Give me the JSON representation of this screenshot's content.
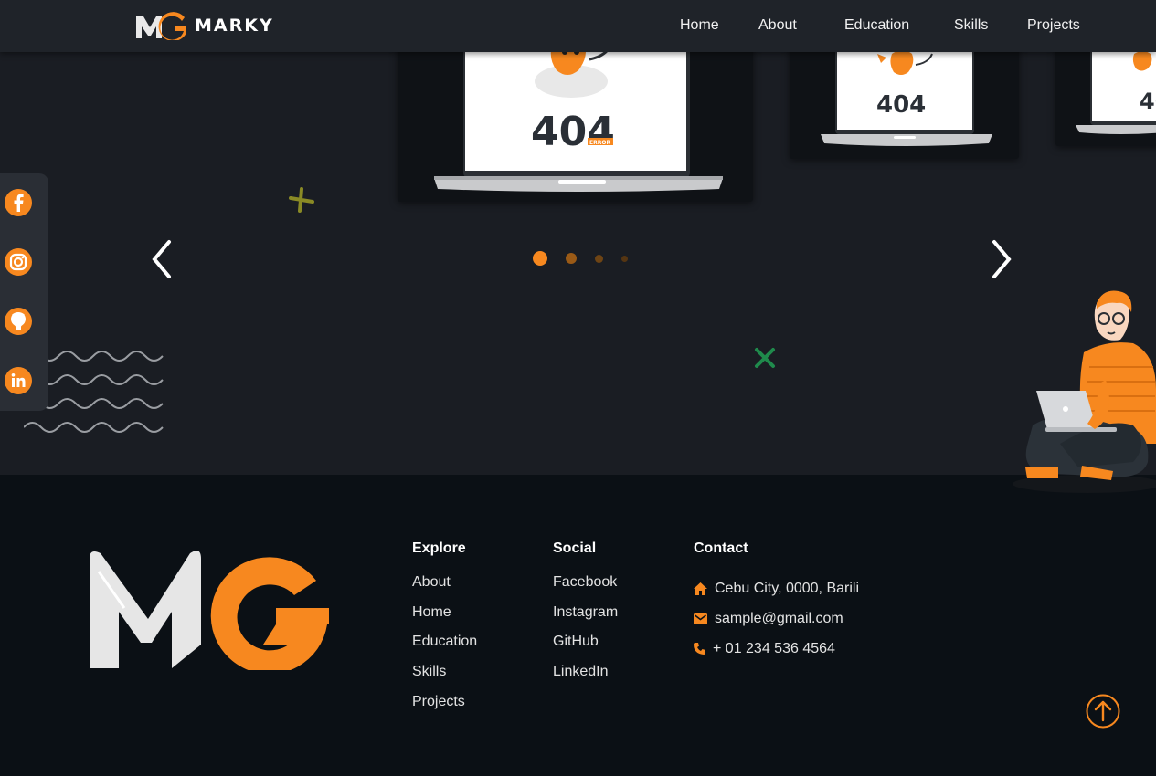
{
  "brand": {
    "name": "MARKY",
    "logo_text": "MG"
  },
  "nav": {
    "items": [
      {
        "label": "Home"
      },
      {
        "label": "About"
      },
      {
        "label": "Education"
      },
      {
        "label": "Skills"
      },
      {
        "label": "Projects"
      }
    ]
  },
  "carousel": {
    "card_text": "404",
    "card_subtext": "ERROR",
    "active_index": 0,
    "slide_count": 4
  },
  "social": [
    "facebook-icon",
    "instagram-icon",
    "github-icon",
    "linkedin-icon"
  ],
  "footer": {
    "explore": {
      "title": "Explore",
      "items": [
        "About",
        "Home",
        "Education",
        "Skills",
        "Projects"
      ]
    },
    "social": {
      "title": "Social",
      "items": [
        "Facebook",
        "Instagram",
        "GitHub",
        "LinkedIn"
      ]
    },
    "contact": {
      "title": "Contact",
      "address": "Cebu City, 0000, Barili",
      "email": "sample@gmail.com",
      "phone": "+ 01 234 536 4564"
    }
  },
  "colors": {
    "accent": "#f7881f",
    "nav_bg": "#1f2329",
    "hero_bg": "#1a1d23",
    "footer_bg": "#0b1015"
  }
}
